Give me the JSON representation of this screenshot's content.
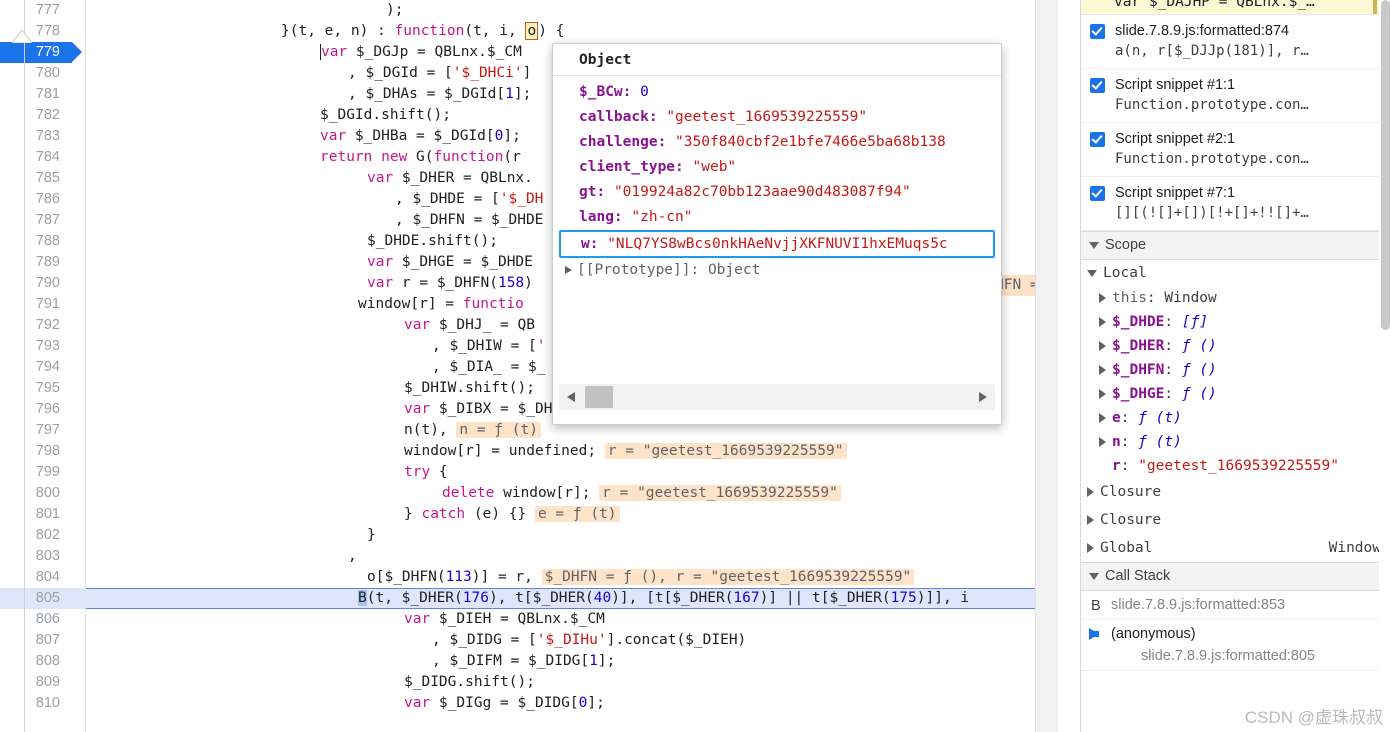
{
  "editor": {
    "first_line": 777,
    "current_execution_line": 805,
    "breakpoint_line": 779,
    "lines": [
      {
        "num": 777,
        "text": ");"
      },
      {
        "num": 778,
        "text": "}(t, e, n) : function(t, i, o) {"
      },
      {
        "num": 779,
        "text": "var $_DGJp = QBLnx.$_CM"
      },
      {
        "num": 780,
        "text": ", $_DGId = ['$_DHCi']"
      },
      {
        "num": 781,
        "text": ", $_DHAs = $_DGId[1];"
      },
      {
        "num": 782,
        "text": "$_DGId.shift();"
      },
      {
        "num": 783,
        "text": "var $_DHBa = $_DGId[0];"
      },
      {
        "num": 784,
        "text": "return new G(function(r"
      },
      {
        "num": 785,
        "text": "var $_DHER = QBLnx."
      },
      {
        "num": 786,
        "text": ", $_DHDE = ['$_DH"
      },
      {
        "num": 787,
        "text": ", $_DHFN = $_DHDE"
      },
      {
        "num": 788,
        "text": "$_DHDE.shift();"
      },
      {
        "num": 789,
        "text": "var $_DHGE = $_DHDE"
      },
      {
        "num": 790,
        "text": "var r = $_DHFN(158)"
      },
      {
        "num": 791,
        "text": "window[r] = functio"
      },
      {
        "num": 792,
        "text": "var $_DHJ_ = QB"
      },
      {
        "num": 793,
        "text": ", $_DHIW = ['"
      },
      {
        "num": 794,
        "text": ", $_DIA_ = $_"
      },
      {
        "num": 795,
        "text": "$_DHIW.shift();"
      },
      {
        "num": 796,
        "text": "var $_DIBX = $_DHIW[0];"
      },
      {
        "num": 797,
        "text": "n(t),"
      },
      {
        "num": 798,
        "text": "window[r] = undefined;"
      },
      {
        "num": 799,
        "text": "try {"
      },
      {
        "num": 800,
        "text": "delete window[r];"
      },
      {
        "num": 801,
        "text": "} catch (e) {}"
      },
      {
        "num": 802,
        "text": "}"
      },
      {
        "num": 803,
        "text": ","
      },
      {
        "num": 804,
        "text": "o[$_DHFN(113)] = r,"
      },
      {
        "num": 805,
        "text": "B(t, $_DHER(176), t[$_DHER(40)], [t[$_DHER(167)] || t[$_DHER(175)]], i"
      },
      {
        "num": 806,
        "text": "var $_DIEH = QBLnx.$_CM"
      },
      {
        "num": 807,
        "text": ", $_DIDG = ['$_DIHu'].concat($_DIEH)"
      },
      {
        "num": 808,
        "text": ", $_DIFM = $_DIDG[1];"
      },
      {
        "num": 809,
        "text": "$_DIDG.shift();"
      },
      {
        "num": 810,
        "text": "var $_DIGg = $_DIDG[0];"
      }
    ],
    "inline_values": {
      "line790": "HFN = ƒ",
      "line797": "n = ƒ (t)",
      "line798": "r = \"geetest_1669539225559\"",
      "line800": "r = \"geetest_1669539225559\"",
      "line801": "e = ƒ (t)",
      "line804": "$_DHFN = ƒ (), r = \"geetest_1669539225559\""
    },
    "hovered_token": "o"
  },
  "popover": {
    "title": "Object",
    "properties": [
      {
        "key": "$_BCw",
        "value": "0",
        "type": "number"
      },
      {
        "key": "callback",
        "value": "\"geetest_1669539225559\"",
        "type": "string"
      },
      {
        "key": "challenge",
        "value": "\"350f840cbf2e1bfe7466e5ba68b138",
        "type": "string"
      },
      {
        "key": "client_type",
        "value": "\"web\"",
        "type": "string"
      },
      {
        "key": "gt",
        "value": "\"019924a82c70bb123aae90d483087f94\"",
        "type": "string"
      },
      {
        "key": "lang",
        "value": "\"zh-cn\"",
        "type": "string"
      },
      {
        "key": "w",
        "value": "\"NLQ7YS8wBcs0nkHAeNvjjXKFNUVI1hxEMuqs5c",
        "type": "string",
        "highlighted": true
      }
    ],
    "prototype_label": "[[Prototype]]: Object"
  },
  "sidebar": {
    "breakpoint_partial_top": "var $_DAJHP = QBLnx.$_…",
    "breakpoints": [
      {
        "checked": true,
        "location": "slide.7.8.9.js:formatted:874",
        "snippet": "a(n, r[$_DJJp(181)], r…"
      },
      {
        "checked": true,
        "location": "Script snippet #1:1",
        "snippet": "Function.prototype.con…"
      },
      {
        "checked": true,
        "location": "Script snippet #2:1",
        "snippet": "Function.prototype.con…"
      },
      {
        "checked": true,
        "location": "Script snippet #7:1",
        "snippet": "[][(![]+[])[!+[]+!![]+…"
      }
    ],
    "scope": {
      "title": "Scope",
      "group": "Local",
      "entries": [
        {
          "name": "this",
          "sep": ": ",
          "value": "Window",
          "kind": "plain",
          "dim": true,
          "arrow": true
        },
        {
          "name": "$_DHDE",
          "sep": ": ",
          "value": "[ƒ]",
          "kind": "fn",
          "arrow": true
        },
        {
          "name": "$_DHER",
          "sep": ": ",
          "value": "ƒ ()",
          "kind": "fn",
          "arrow": true
        },
        {
          "name": "$_DHFN",
          "sep": ": ",
          "value": "ƒ ()",
          "kind": "fn",
          "arrow": true
        },
        {
          "name": "$_DHGE",
          "sep": ": ",
          "value": "ƒ ()",
          "kind": "fn",
          "arrow": true
        },
        {
          "name": "e",
          "sep": ": ",
          "value": "ƒ (t)",
          "kind": "fn",
          "arrow": true
        },
        {
          "name": "n",
          "sep": ": ",
          "value": "ƒ (t)",
          "kind": "fn",
          "arrow": true
        },
        {
          "name": "r",
          "sep": ": ",
          "value": "\"geetest_1669539225559\"",
          "kind": "str",
          "arrow": false
        }
      ],
      "closures": [
        {
          "label": "Closure",
          "right": ""
        },
        {
          "label": "Closure",
          "right": ""
        },
        {
          "label": "Global",
          "right": "Window"
        }
      ]
    },
    "call_stack": {
      "title": "Call Stack",
      "frames": [
        {
          "badge": "B",
          "name": "",
          "file": "slide.7.8.9.js:formatted:853",
          "active": false
        },
        {
          "badge": "",
          "name": "(anonymous)",
          "file": "slide.7.8.9.js:formatted:805",
          "active": true
        }
      ]
    }
  },
  "watermark": "CSDN @虚珠叔叔",
  "colors": {
    "accent": "#1a73e8",
    "exec_line": "#dfe6fb",
    "inline_value": "#ffe3c8",
    "string": "#c41a16",
    "keyword": "#c5168c",
    "number": "#1c00cf",
    "property": "#881391",
    "highlight_box": "#1a9cf0",
    "breakpoint_yellow": "#fdf8d4"
  }
}
